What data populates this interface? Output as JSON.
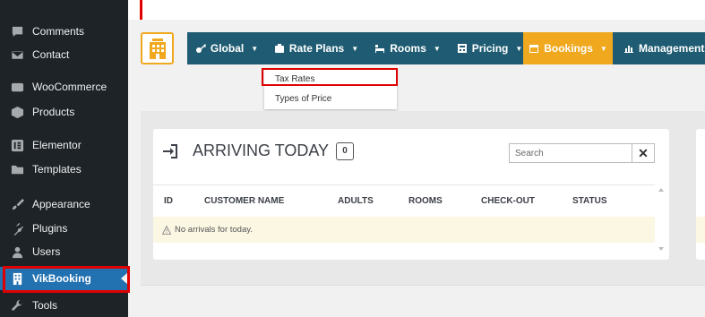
{
  "sidebar": {
    "items": [
      {
        "label": "Comments",
        "icon": "comment-icon"
      },
      {
        "label": "Contact",
        "icon": "mail-icon"
      },
      {
        "label": "WooCommerce",
        "icon": "woocommerce-icon"
      },
      {
        "label": "Products",
        "icon": "box-icon"
      },
      {
        "label": "Elementor",
        "icon": "elementor-icon"
      },
      {
        "label": "Templates",
        "icon": "folder-icon"
      },
      {
        "label": "Appearance",
        "icon": "paintbrush-icon"
      },
      {
        "label": "Plugins",
        "icon": "plug-icon"
      },
      {
        "label": "Users",
        "icon": "user-icon"
      },
      {
        "label": "VikBooking",
        "icon": "building-icon"
      },
      {
        "label": "Tools",
        "icon": "wrench-icon"
      }
    ],
    "active": "VikBooking"
  },
  "menubar": {
    "items": [
      {
        "label": "Global",
        "icon": "key-icon"
      },
      {
        "label": "Rate Plans",
        "icon": "briefcase-icon"
      },
      {
        "label": "Rooms",
        "icon": "bed-icon"
      },
      {
        "label": "Pricing",
        "icon": "calculator-icon"
      },
      {
        "label": "Bookings",
        "icon": "calendar-icon"
      },
      {
        "label": "Management",
        "icon": "chart-icon"
      }
    ],
    "dropdown": [
      "Tax Rates",
      "Types of Price"
    ]
  },
  "arriving": {
    "title": "ARRIVING TODAY",
    "count": "0",
    "search_placeholder": "Search",
    "clear_label": "✕",
    "columns": [
      "ID",
      "CUSTOMER NAME",
      "ADULTS",
      "ROOMS",
      "CHECK-OUT",
      "STATUS"
    ],
    "empty_message": "No arrivals for today."
  },
  "colors": {
    "menu_dark": "#1f5c73",
    "menu_orange": "#f0a81e",
    "highlight_red": "#e00000",
    "sidebar_bg": "#1d2327",
    "active_blue": "#2271b1"
  }
}
